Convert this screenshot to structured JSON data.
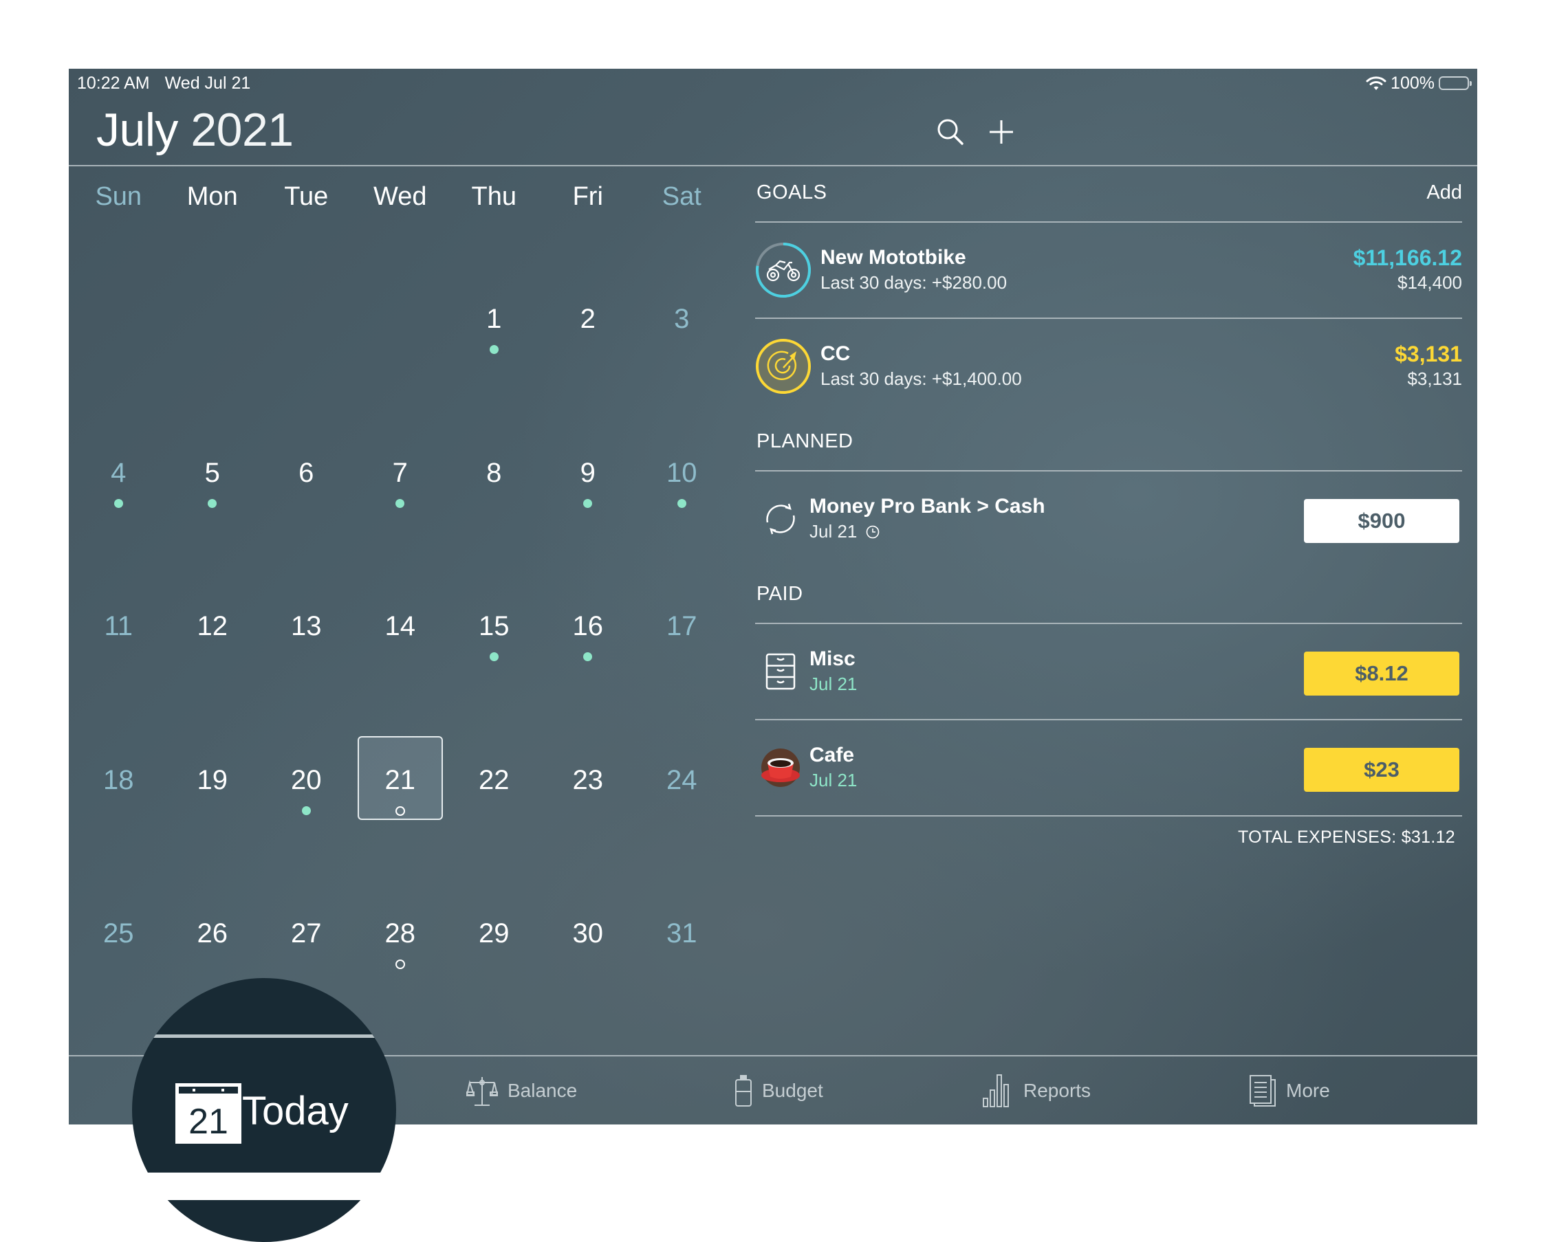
{
  "status_bar": {
    "time": "10:22 AM",
    "date": "Wed Jul 21",
    "wifi_icon": "wifi-icon",
    "battery_percent": "100%",
    "battery_level": 1.0
  },
  "header": {
    "month": "July",
    "year": "2021",
    "search_icon": "search-icon",
    "add_icon": "plus-icon"
  },
  "calendar": {
    "weekdays": [
      "Sun",
      "Mon",
      "Tue",
      "Wed",
      "Thu",
      "Fri",
      "Sat"
    ],
    "leading_blanks": 4,
    "selected_day": 21,
    "days": [
      {
        "d": "1",
        "dot": "filled"
      },
      {
        "d": "2",
        "dot": ""
      },
      {
        "d": "3",
        "dot": ""
      },
      {
        "d": "4",
        "dot": "filled"
      },
      {
        "d": "5",
        "dot": "filled"
      },
      {
        "d": "6",
        "dot": ""
      },
      {
        "d": "7",
        "dot": "filled"
      },
      {
        "d": "8",
        "dot": ""
      },
      {
        "d": "9",
        "dot": "filled"
      },
      {
        "d": "10",
        "dot": "filled"
      },
      {
        "d": "11",
        "dot": ""
      },
      {
        "d": "12",
        "dot": ""
      },
      {
        "d": "13",
        "dot": ""
      },
      {
        "d": "14",
        "dot": ""
      },
      {
        "d": "15",
        "dot": "filled"
      },
      {
        "d": "16",
        "dot": "filled"
      },
      {
        "d": "17",
        "dot": ""
      },
      {
        "d": "18",
        "dot": ""
      },
      {
        "d": "19",
        "dot": ""
      },
      {
        "d": "20",
        "dot": "filled"
      },
      {
        "d": "21",
        "dot": "hollow"
      },
      {
        "d": "22",
        "dot": ""
      },
      {
        "d": "23",
        "dot": ""
      },
      {
        "d": "24",
        "dot": ""
      },
      {
        "d": "25",
        "dot": ""
      },
      {
        "d": "26",
        "dot": ""
      },
      {
        "d": "27",
        "dot": ""
      },
      {
        "d": "28",
        "dot": "hollow"
      },
      {
        "d": "29",
        "dot": ""
      },
      {
        "d": "30",
        "dot": ""
      },
      {
        "d": "31",
        "dot": ""
      }
    ]
  },
  "goals": {
    "title": "GOALS",
    "add_label": "Add",
    "items": [
      {
        "name": "New Mototbike",
        "sub": "Last 30 days: +$280.00",
        "saved": "$11,166.12",
        "target": "$14,400",
        "progress": 0.775,
        "color": "#4dd0e1",
        "icon": "motorbike-icon"
      },
      {
        "name": "CC",
        "sub": "Last 30 days: +$1,400.00",
        "saved": "$3,131",
        "target": "$3,131",
        "progress": 1.0,
        "color": "#fdd835",
        "icon": "target-icon"
      }
    ]
  },
  "planned": {
    "title": "PLANNED",
    "items": [
      {
        "name": "Money Pro Bank > Cash",
        "date": "Jul 21",
        "amount": "$900",
        "icon": "transfer-icon"
      }
    ]
  },
  "paid": {
    "title": "PAID",
    "items": [
      {
        "name": "Misc",
        "date": "Jul 21",
        "amount": "$8.12",
        "icon": "drawers-icon"
      },
      {
        "name": "Cafe",
        "date": "Jul 21",
        "amount": "$23",
        "icon": "coffee-cup-icon"
      }
    ],
    "total": "TOTAL EXPENSES: $31.12"
  },
  "tabbar": {
    "today": {
      "label": "Today",
      "day": "21"
    },
    "balance": "Balance",
    "budget": "Budget",
    "reports": "Reports",
    "more": "More"
  },
  "colors": {
    "accent_cyan": "#4dd0e1",
    "accent_yellow": "#fdd835",
    "dot_green": "#8ee6c8",
    "weekend": "#8fbccb"
  }
}
